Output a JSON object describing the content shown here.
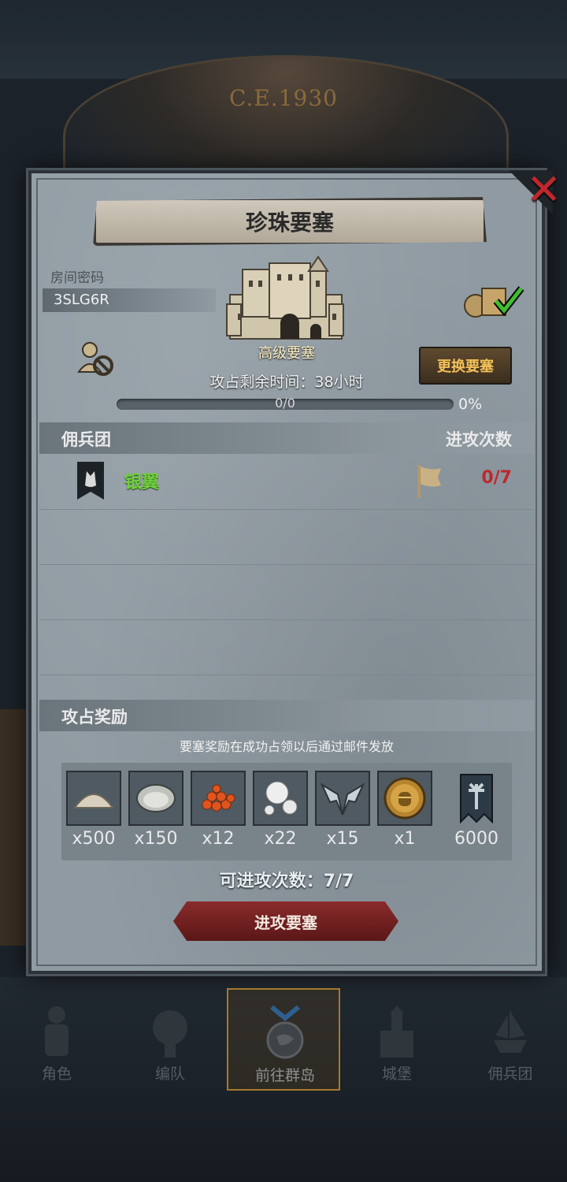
{
  "background": {
    "era_text": "C.E.1930"
  },
  "dialog": {
    "title": "珍珠要塞",
    "room_code_label": "房间密码",
    "room_code": "3SLG6R",
    "fortress_tier": "高级要塞",
    "change_fortress_button": "更换要塞",
    "capture_timer": "攻占剩余时间：38小时",
    "progress": {
      "label": "0/0",
      "percent_text": "0%",
      "fraction": 0
    },
    "mercenary_header": "佣兵团",
    "attack_count_header": "进攻次数",
    "mercenaries": [
      {
        "name": "银翼",
        "attacks": "0/7"
      }
    ],
    "reward_header": "攻占奖励",
    "reward_note": "要塞奖励在成功占领以后通过邮件发放",
    "rewards": [
      {
        "icon": "sand-icon",
        "count": "x500"
      },
      {
        "icon": "oyster-icon",
        "count": "x150"
      },
      {
        "icon": "roe-icon",
        "count": "x12"
      },
      {
        "icon": "pearl-icon",
        "count": "x22"
      },
      {
        "icon": "wings-emblem-icon",
        "count": "x15"
      },
      {
        "icon": "gold-helmet-coin-icon",
        "count": "x1"
      },
      {
        "icon": "guild-banner-icon",
        "count": "6000"
      }
    ],
    "attempts_text": "可进攻次数：7/7",
    "attack_button": "进攻要塞"
  },
  "nav": {
    "items": [
      {
        "label": "角色",
        "icon": "knight-icon"
      },
      {
        "label": "编队",
        "icon": "formation-icon"
      },
      {
        "label": "前往群岛",
        "icon": "islands-compass-icon"
      },
      {
        "label": "城堡",
        "icon": "castle-icon"
      },
      {
        "label": "佣兵团",
        "icon": "mercenary-ship-icon"
      }
    ],
    "active_index": 2
  },
  "colors": {
    "panel": "#8f9aa2",
    "gold_accent": "#f3c158",
    "red_accent": "#c0272d",
    "green_name": "#6fcf3c"
  }
}
